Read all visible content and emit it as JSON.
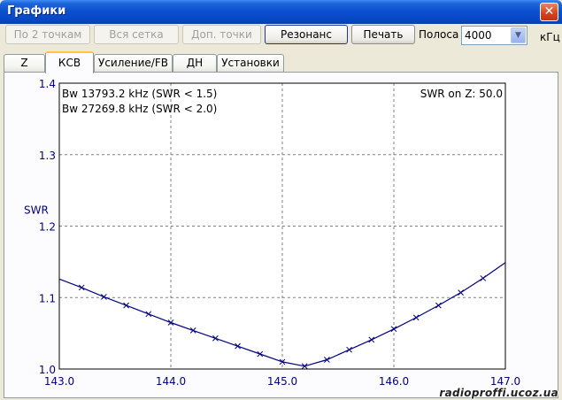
{
  "window": {
    "title": "Графики",
    "close_glyph": "✕"
  },
  "toolbar": {
    "btn_two_points": "По 2 точкам",
    "btn_full_grid": "Вся сетка",
    "btn_extra_points": "Доп. точки",
    "btn_resonance": "Резонанс",
    "btn_print": "Печать",
    "band_label": "Полоса",
    "band_value": "4000",
    "band_unit": "кГц"
  },
  "tabs": [
    {
      "label": "Z"
    },
    {
      "label": "КСВ"
    },
    {
      "label": "Усиление/FB"
    },
    {
      "label": "ДН"
    },
    {
      "label": "Установки"
    }
  ],
  "chart_data": {
    "type": "line",
    "ylabel": "SWR",
    "xlim": [
      143.0,
      147.0
    ],
    "ylim": [
      1.0,
      1.4
    ],
    "x_ticks": [
      "143.0",
      "144.0",
      "145.0",
      "146.0",
      "147.0"
    ],
    "y_ticks": [
      "1.4",
      "1.3",
      "1.2",
      "1.1",
      "1.0"
    ],
    "grid": true,
    "annotations": [
      "Bw 13793.2 kHz (SWR < 1.5)",
      "Bw 27269.8 kHz (SWR < 2.0)",
      "SWR on Z: 50.0"
    ],
    "series": [
      {
        "color": "#00007f",
        "x": [
          143.0,
          143.2,
          143.4,
          143.6,
          143.8,
          144.0,
          144.2,
          144.4,
          144.6,
          144.8,
          145.0,
          145.2,
          145.4,
          145.6,
          145.8,
          146.0,
          146.2,
          146.4,
          146.6,
          146.8,
          147.0
        ],
        "y": [
          1.126,
          1.114,
          1.101,
          1.089,
          1.077,
          1.065,
          1.054,
          1.043,
          1.032,
          1.021,
          1.01,
          1.004,
          1.013,
          1.027,
          1.041,
          1.056,
          1.072,
          1.089,
          1.107,
          1.127,
          1.149
        ]
      }
    ]
  },
  "watermark": "radioproffi.ucoz.ua"
}
